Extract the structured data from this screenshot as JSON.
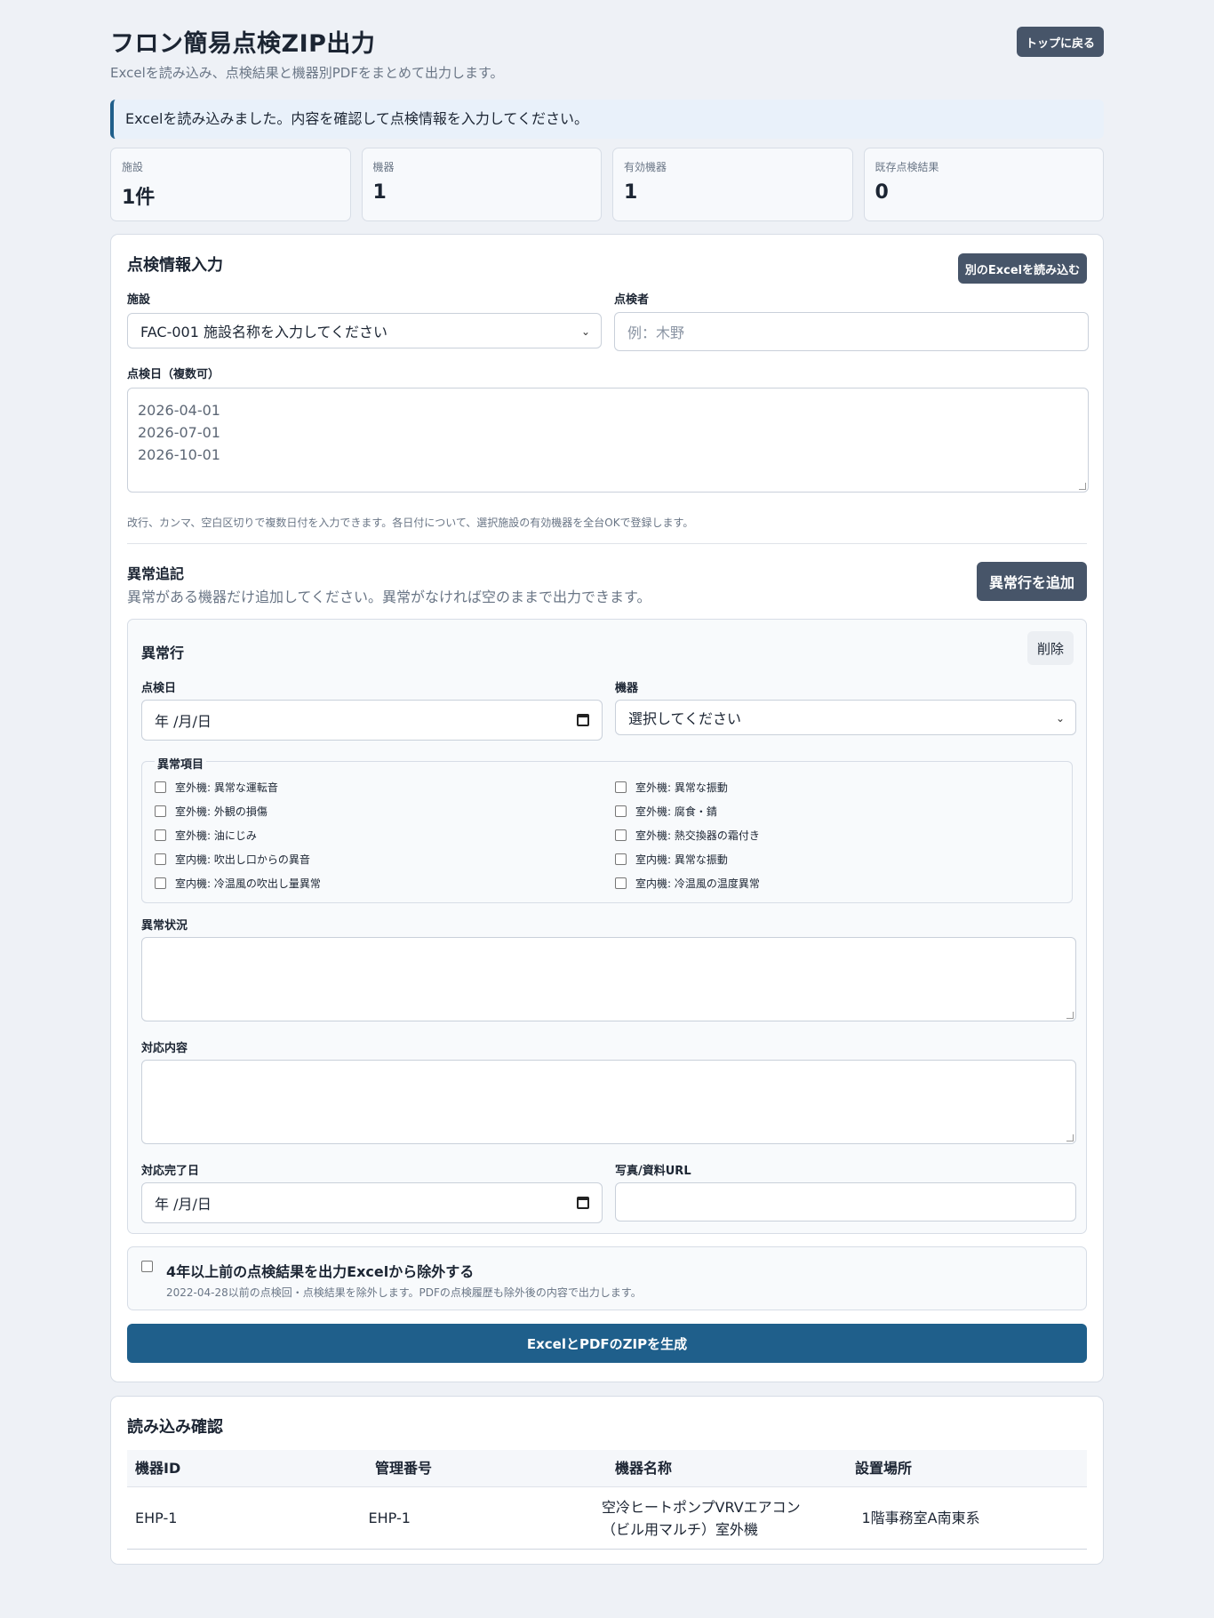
{
  "header": {
    "title": "フロン簡易点検ZIP出力",
    "subtitle": "Excelを読み込み、点検結果と機器別PDFをまとめて出力します。",
    "top_button": "トップに戻る"
  },
  "notice": "Excelを読み込みました。内容を確認して点検情報を入力してください。",
  "stats": [
    {
      "label": "施設",
      "value": "1件"
    },
    {
      "label": "機器",
      "value": "1"
    },
    {
      "label": "有効機器",
      "value": "1"
    },
    {
      "label": "既存点検結果",
      "value": "0"
    }
  ],
  "form": {
    "title": "点検情報入力",
    "reload_button": "別のExcelを読み込む",
    "facility_label": "施設",
    "facility_value": "FAC-001 施設名称を入力してください",
    "inspector_label": "点検者",
    "inspector_placeholder": "例：木野",
    "dates_label": "点検日（複数可）",
    "dates": [
      "2026-04-01",
      "2026-07-01",
      "2026-10-01"
    ],
    "dates_hint": "改行、カンマ、空白区切りで複数日付を入力できます。各日付について、選択施設の有効機器を全台OKで登録します。"
  },
  "anomaly": {
    "section_title": "異常追記",
    "section_desc": "異常がある機器だけ追加してください。異常がなければ空のままで出力できます。",
    "add_button": "異常行を追加",
    "card_title": "異常行",
    "delete_button": "削除",
    "date_label": "点検日",
    "date_value": "年 /月/日",
    "device_label": "機器",
    "device_value": "選択してください",
    "items_legend": "異常項目",
    "items": [
      "室外機: 異常な運転音",
      "室外機: 異常な振動",
      "室外機: 外観の損傷",
      "室外機: 腐食・錆",
      "室外機: 油にじみ",
      "室外機: 熱交換器の霜付き",
      "室内機: 吹出し口からの異音",
      "室内機: 異常な振動",
      "室内機: 冷温風の吹出し量異常",
      "室内機: 冷温風の温度異常"
    ],
    "status_label": "異常状況",
    "action_label": "対応内容",
    "completion_label": "対応完了日",
    "completion_value": "年 /月/日",
    "url_label": "写真/資料URL"
  },
  "exclude": {
    "title": "4年以上前の点検結果を出力Excelから除外する",
    "desc": "2022-04-28以前の点検回・点検結果を除外します。PDFの点検履歴も除外後の内容で出力します。"
  },
  "generate_button": "ExcelとPDFのZIPを生成",
  "confirm": {
    "title": "読み込み確認",
    "columns": [
      "機器ID",
      "管理番号",
      "機器名称",
      "設置場所"
    ],
    "rows": [
      [
        "EHP-1",
        "EHP-1",
        "空冷ヒートポンプVRVエアコン（ビル用マルチ）室外機",
        "1階事務室A南東系"
      ]
    ]
  }
}
